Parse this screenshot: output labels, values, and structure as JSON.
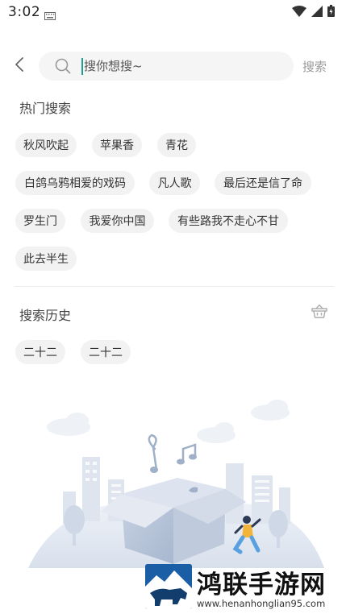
{
  "status_bar": {
    "time": "3:02",
    "icons": [
      "keyboard-icon",
      "wifi-icon",
      "signal-icon",
      "battery-icon"
    ]
  },
  "header": {
    "back_icon": "chevron-left-icon",
    "search": {
      "placeholder": "搜你想搜~",
      "value": ""
    },
    "search_button_label": "搜索"
  },
  "hot_search": {
    "title": "热门搜索",
    "tags": [
      "秋风吹起",
      "苹果香",
      "青花",
      "白鸽乌鸦相爱的戏码",
      "凡人歌",
      "最后还是信了命",
      "罗生门",
      "我爱你中国",
      "有些路我不走心不甘",
      "此去半生"
    ]
  },
  "history": {
    "title": "搜索历史",
    "clear_icon": "basket-icon",
    "items": [
      "二十二",
      "二十二"
    ]
  },
  "illustration": "city-music-box-illustration",
  "watermark": {
    "title": "鸿联手游网",
    "url": "www.henanhonglian95.com"
  },
  "colors": {
    "accent": "#1e9e8e",
    "chip_bg": "#f2f2f2",
    "search_bg": "#f5f5f5",
    "muted_text": "#9a9a9a"
  }
}
